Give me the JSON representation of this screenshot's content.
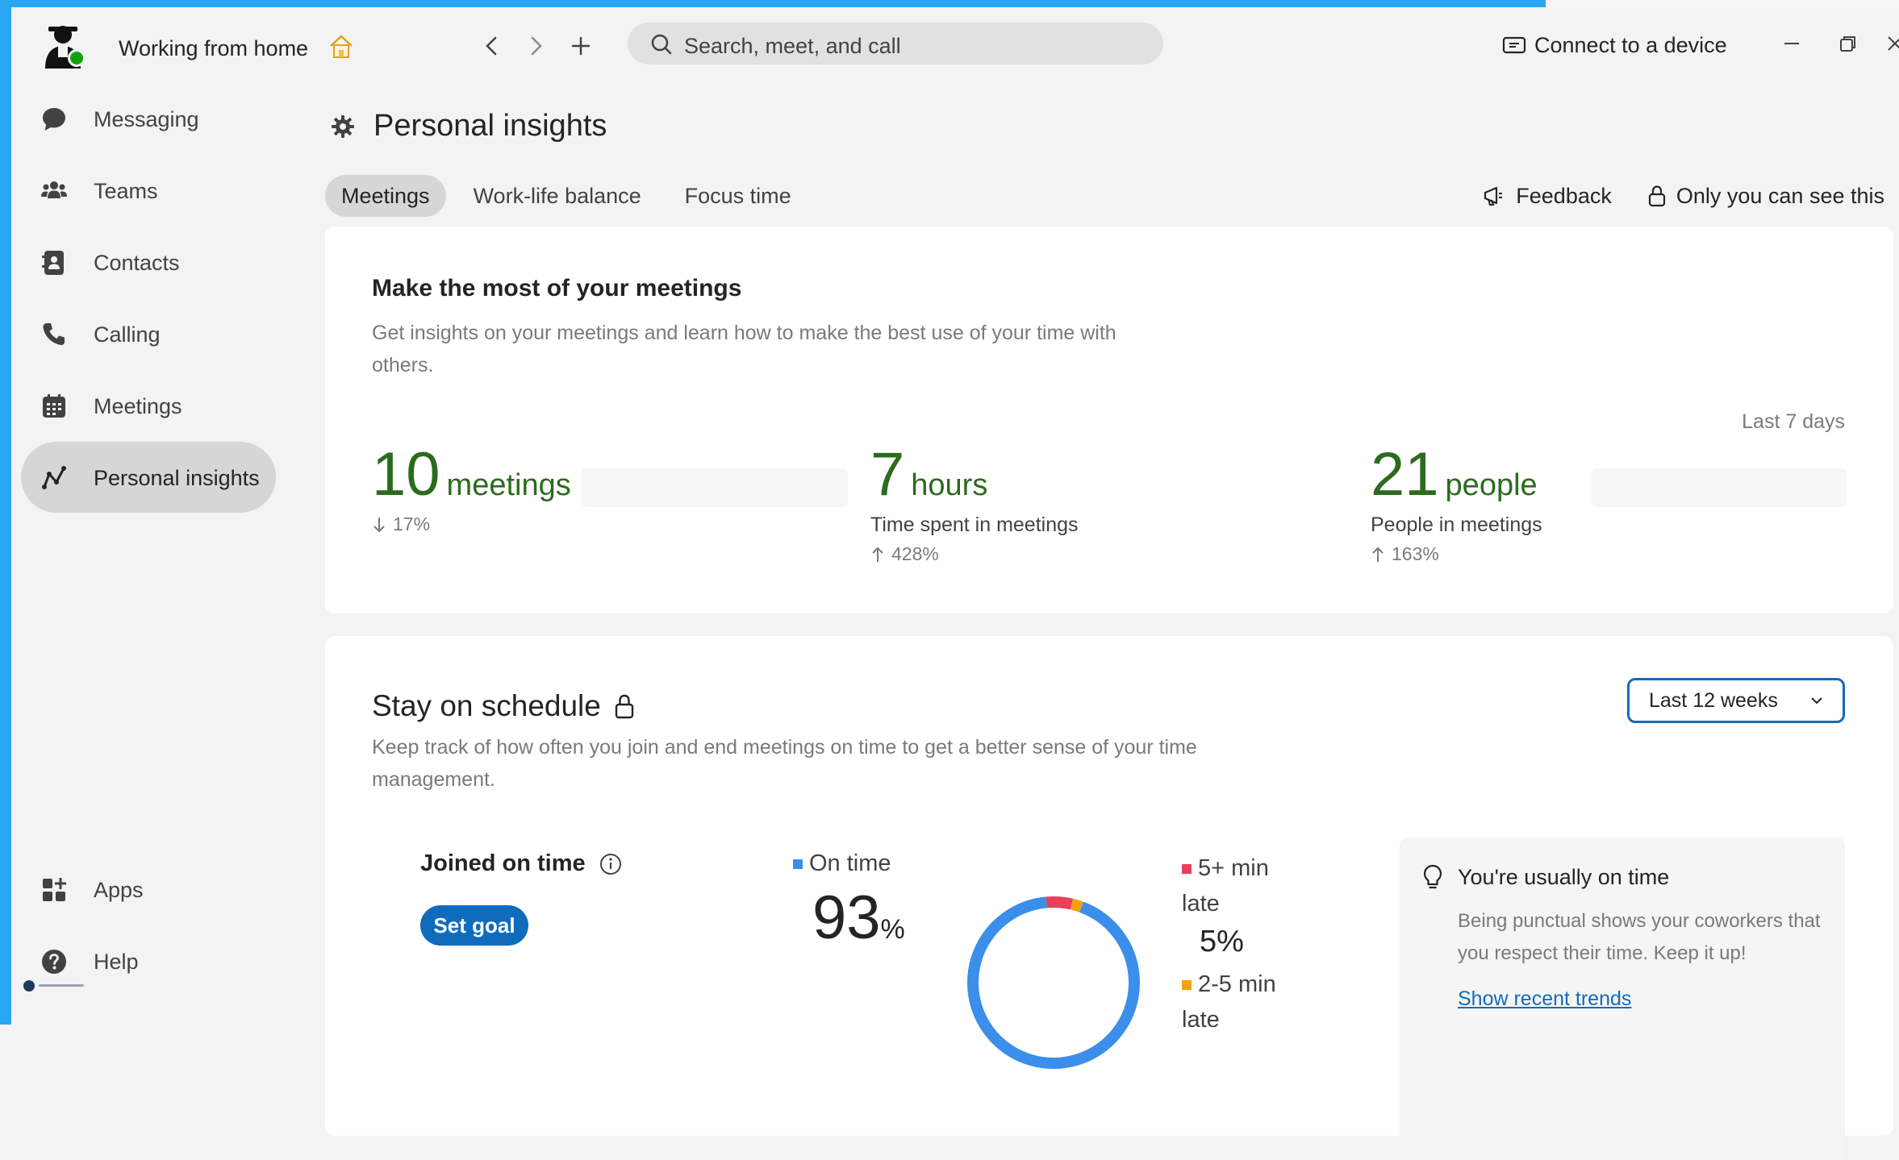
{
  "titlebar": {
    "presence_status": "Working from home",
    "search_placeholder": "Search, meet, and call",
    "connect_label": "Connect to a device"
  },
  "sidebar": {
    "items": [
      {
        "label": "Messaging",
        "icon": "chat-bubble-icon"
      },
      {
        "label": "Teams",
        "icon": "teams-icon"
      },
      {
        "label": "Contacts",
        "icon": "contacts-icon"
      },
      {
        "label": "Calling",
        "icon": "phone-icon"
      },
      {
        "label": "Meetings",
        "icon": "calendar-icon"
      },
      {
        "label": "Personal insights",
        "icon": "insights-icon",
        "active": true
      }
    ],
    "bottom_items": [
      {
        "label": "Apps",
        "icon": "apps-icon"
      },
      {
        "label": "Help",
        "icon": "help-icon"
      }
    ]
  },
  "page": {
    "title": "Personal insights",
    "tabs": [
      {
        "label": "Meetings",
        "active": true
      },
      {
        "label": "Work-life balance"
      },
      {
        "label": "Focus time"
      }
    ],
    "feedback_label": "Feedback",
    "privacy_label": "Only you can see this"
  },
  "meetings_card": {
    "heading": "Make the most of your meetings",
    "description": "Get insights on your meetings and learn how to make the best use of your time with others.",
    "period": "Last 7 days",
    "metrics": [
      {
        "value": "10",
        "unit": "meetings",
        "subtitle": "",
        "change": "17%",
        "direction": "down"
      },
      {
        "value": "7",
        "unit": "hours",
        "subtitle": "Time spent in meetings",
        "change": "428%",
        "direction": "up"
      },
      {
        "value": "21",
        "unit": "people",
        "subtitle": "People in meetings",
        "change": "163%",
        "direction": "up"
      }
    ]
  },
  "schedule_card": {
    "heading": "Stay on schedule",
    "description": "Keep track of how often you join and end meetings on time to get a better sense of your time management.",
    "range_select": "Last 12 weeks",
    "joined_label": "Joined on time",
    "goal_button": "Set goal",
    "on_time_label": "On time",
    "on_time_value": "93",
    "on_time_unit": "%",
    "late5_label": "5+ min late",
    "late5_value": "5%",
    "late25_label": "2-5 min late",
    "tip_title": "You're usually on time",
    "tip_body": "Being punctual shows your coworkers that you respect their time. Keep it up!",
    "tip_link": "Show recent trends"
  },
  "chart_data": {
    "type": "pie",
    "categories": [
      "On time",
      "5+ min late",
      "2-5 min late"
    ],
    "values": [
      93,
      5,
      2
    ],
    "colors": [
      "#3b8eea",
      "#e8405a",
      "#f0a30a"
    ]
  },
  "colors": {
    "accent": "#0f6cbd",
    "metric_green": "#2b6b1e",
    "frame": "#2aa7f2"
  }
}
